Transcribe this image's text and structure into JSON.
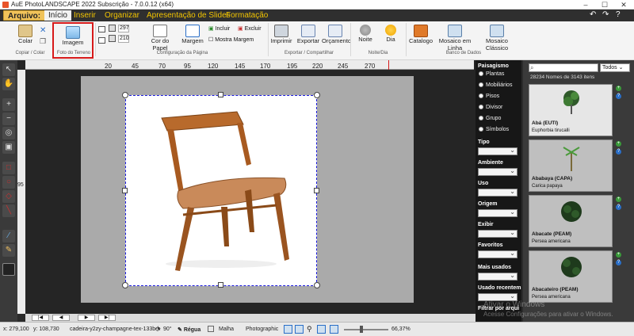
{
  "window": {
    "title": "AuE PhotoLANDSCAPE 2022 Subscrição - 7.0.0.12 (x64)"
  },
  "menu": {
    "file": "Arquivo:",
    "items": [
      "Início",
      "Inserir",
      "Organizar",
      "Apresentação de Slides",
      "Formatação"
    ]
  },
  "ribbon": {
    "colar": "Colar",
    "group_colar": "Copiar / Colar",
    "imagem": "Imagem",
    "group_foto": "Foto do Terreno",
    "width_val": "297",
    "height_val": "210",
    "cor_papel": "Cor do Papel",
    "margem": "Margem",
    "incluir": "Incluir",
    "excluir": "Excluir",
    "mostra_margem": "Mostra Margem",
    "group_config": "Configuração da Página",
    "imprimir": "Imprimir",
    "exportar": "Exportar",
    "orcamento": "Orçamento",
    "group_exportar": "Exportar / Compartilhar",
    "noite": "Noite",
    "dia": "Dia",
    "group_noite": "Noite/Dia",
    "catalogo": "Catalogo",
    "mosaico_linha": "Mosaico em Linha",
    "mosaico_classico": "Mosaico Clássico",
    "group_banco": "Banco de Dados"
  },
  "ruler": {
    "ticks": [
      "20",
      "45",
      "70",
      "95",
      "120",
      "145",
      "170",
      "195",
      "220",
      "245",
      "270"
    ],
    "vticks": [
      "95"
    ]
  },
  "filters": {
    "paisagismo": "Paisagismo",
    "radios": [
      "Plantas",
      "Mobiliários",
      "Pisos",
      "Divisor",
      "Grupo",
      "Símbolos"
    ],
    "labels": [
      "Tipo",
      "Ambiente",
      "Uso",
      "Origem",
      "Exibir",
      "Favoritos",
      "Mais usados",
      "Usado recentem",
      "Filtrar por arqui"
    ]
  },
  "plants": {
    "dropdown": "Todos",
    "count": "28234 Nomes de 3143 itens",
    "cards": [
      {
        "name": "Abá (EUTI)",
        "sci": "Euphorbia tirucalli"
      },
      {
        "name": "Ababaya (CAPA)",
        "sci": "Carica papaya"
      },
      {
        "name": "Abacate (PEAM)",
        "sci": "Persea americana"
      },
      {
        "name": "Abacateiro (PEAM)",
        "sci": "Persea americana"
      }
    ]
  },
  "status": {
    "x": "x: 279,100",
    "y": "y: 108,730",
    "file": "cadeira-y2zy-champagne-tex-133b-h",
    "angle": "90°",
    "regua": "Régua",
    "malha": "Malha",
    "mode": "Photographic",
    "zoom": "66,37%"
  },
  "watermark": {
    "line1": "Ativar o Windows",
    "line2": "Acesse Configurações para ativar o Windows."
  },
  "colors": {
    "accent": "#f2c400",
    "highlight": "#d71a1a",
    "selection": "#1a1adc"
  }
}
